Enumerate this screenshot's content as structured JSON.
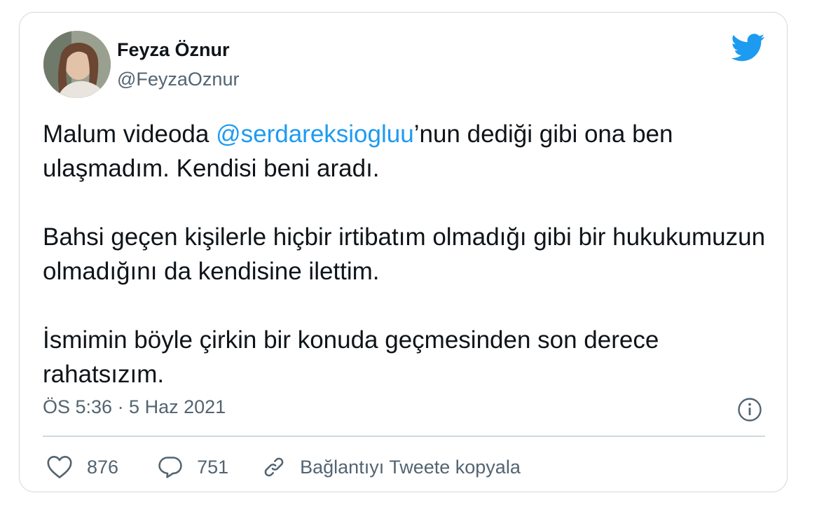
{
  "author": {
    "name": "Feyza Öznur",
    "handle": "@FeyzaOznur",
    "avatar_icon": "profile-photo"
  },
  "tweet": {
    "paragraphs": [
      {
        "segments": [
          {
            "text": "Malum videoda ",
            "mention": false
          },
          {
            "text": "@serdareksiogluu",
            "mention": true
          },
          {
            "text": "’nun dediği gibi ona ben ulaşmadım. Kendisi beni aradı.",
            "mention": false
          }
        ]
      },
      {
        "segments": [
          {
            "text": "Bahsi geçen kişilerle hiçbir irtibatım olmadığı gibi bir hukukumuzun olmadığını da kendisine ilettim.",
            "mention": false
          }
        ]
      },
      {
        "segments": [
          {
            "text": "İsmimin böyle çirkin bir konuda geçmesinden son derece rahatsızım.",
            "mention": false
          }
        ]
      }
    ],
    "timestamp": "ÖS 5:36 · 5 Haz 2021"
  },
  "actions": {
    "likes": "876",
    "replies": "751",
    "copy_link_label": "Bağlantıyı Tweete kopyala"
  },
  "colors": {
    "mention": "#1d9bf0",
    "twitter_blue": "#1d9bf0",
    "text": "#0f1419",
    "secondary": "#536471",
    "border": "#cfd9de"
  },
  "icons": {
    "brand": "twitter-bird-icon",
    "info": "info-icon",
    "like": "heart-icon",
    "reply": "speech-bubble-icon",
    "copy": "link-icon"
  }
}
